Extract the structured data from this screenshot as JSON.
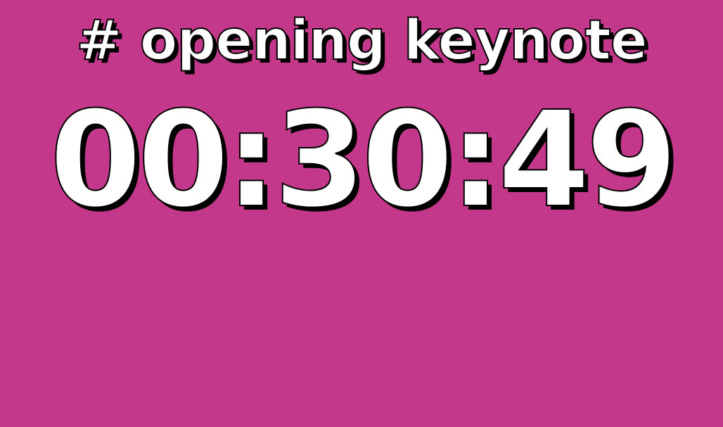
{
  "colors": {
    "background": "#c4388c",
    "text": "#ffffff",
    "outline": "#000000"
  },
  "countdown": {
    "title": "# opening keynote",
    "time": "00:30:49"
  }
}
